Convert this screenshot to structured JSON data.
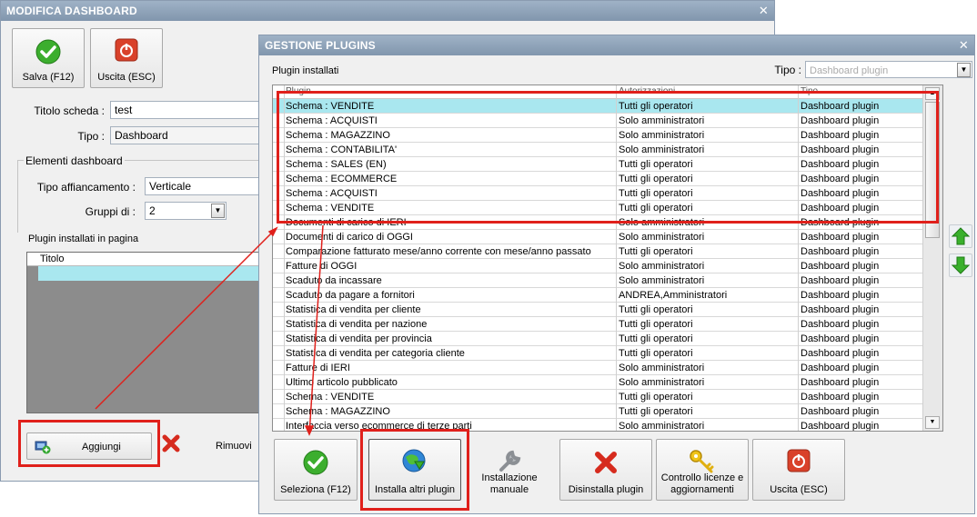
{
  "back_window": {
    "title": "MODIFICA DASHBOARD",
    "toolbar": {
      "save_label": "Salva (F12)",
      "exit_label": "Uscita (ESC)"
    },
    "titolo_label": "Titolo scheda :",
    "titolo_value": "test",
    "tipo_label": "Tipo :",
    "tipo_value": "Dashboard",
    "elementi_group": "Elementi dashboard",
    "affiancamento_label": "Tipo affiancamento :",
    "affiancamento_value": "Verticale",
    "gruppi_label": "Gruppi di :",
    "gruppi_value": "2",
    "plugin_pagina_label": "Plugin installati in pagina",
    "grid_header": "Titolo",
    "add_label": "Aggiungi",
    "remove_label": "Rimuovi"
  },
  "plugins_window": {
    "title": "GESTIONE PLUGINS",
    "installed_label": "Plugin installati",
    "tipo_label": "Tipo :",
    "tipo_placeholder": "Dashboard plugin",
    "columns": [
      "Plugin",
      "Autorizzazioni",
      "Tipo"
    ],
    "rows": [
      [
        "Schema : VENDITE",
        "Tutti gli operatori",
        "Dashboard plugin"
      ],
      [
        "Schema : ACQUISTI",
        "Solo amministratori",
        "Dashboard plugin"
      ],
      [
        "Schema : MAGAZZINO",
        "Solo amministratori",
        "Dashboard plugin"
      ],
      [
        "Schema : CONTABILITA'",
        "Solo amministratori",
        "Dashboard plugin"
      ],
      [
        "Schema : SALES (EN)",
        "Tutti gli operatori",
        "Dashboard plugin"
      ],
      [
        "Schema : ECOMMERCE",
        "Tutti gli operatori",
        "Dashboard plugin"
      ],
      [
        "Schema : ACQUISTI",
        "Tutti gli operatori",
        "Dashboard plugin"
      ],
      [
        "Schema : VENDITE",
        "Tutti gli operatori",
        "Dashboard plugin"
      ],
      [
        "Documenti di carico di IERI",
        "Solo amministratori",
        "Dashboard plugin"
      ],
      [
        "Documenti di carico di OGGI",
        "Solo amministratori",
        "Dashboard plugin"
      ],
      [
        "Comparazione fatturato mese/anno corrente con mese/anno passato",
        "Tutti gli operatori",
        "Dashboard plugin"
      ],
      [
        "Fatture di OGGI",
        "Solo amministratori",
        "Dashboard plugin"
      ],
      [
        "Scaduto da incassare",
        "Solo amministratori",
        "Dashboard plugin"
      ],
      [
        "Scaduto da pagare a fornitori",
        "ANDREA,Amministratori",
        "Dashboard plugin"
      ],
      [
        "Statistica di vendita per cliente",
        "Tutti gli operatori",
        "Dashboard plugin"
      ],
      [
        "Statistica di vendita per nazione",
        "Tutti gli operatori",
        "Dashboard plugin"
      ],
      [
        "Statistica di vendita per provincia",
        "Tutti gli operatori",
        "Dashboard plugin"
      ],
      [
        "Statistica di vendita per categoria cliente",
        "Tutti gli operatori",
        "Dashboard plugin"
      ],
      [
        "Fatture di IERI",
        "Solo amministratori",
        "Dashboard plugin"
      ],
      [
        "Ultimo articolo pubblicato",
        "Solo amministratori",
        "Dashboard plugin"
      ],
      [
        "Schema : VENDITE",
        "Tutti gli operatori",
        "Dashboard plugin"
      ],
      [
        "Schema : MAGAZZINO",
        "Tutti gli operatori",
        "Dashboard plugin"
      ],
      [
        "Interfaccia verso ecommerce di terze parti",
        "Solo amministratori",
        "Dashboard plugin"
      ]
    ],
    "buttons": {
      "select": "Seleziona (F12)",
      "install_more": "Installa altri plugin",
      "manual_1": "Installazione",
      "manual_2": "manuale",
      "uninstall": "Disinstalla plugin",
      "license_1": "Controllo licenze e",
      "license_2": "aggiornamenti",
      "exit": "Uscita (ESC)"
    }
  },
  "colors": {
    "titlebar": "#8aa0b6",
    "selected_row": "#a9e7ef",
    "highlight": "#e0201b"
  }
}
